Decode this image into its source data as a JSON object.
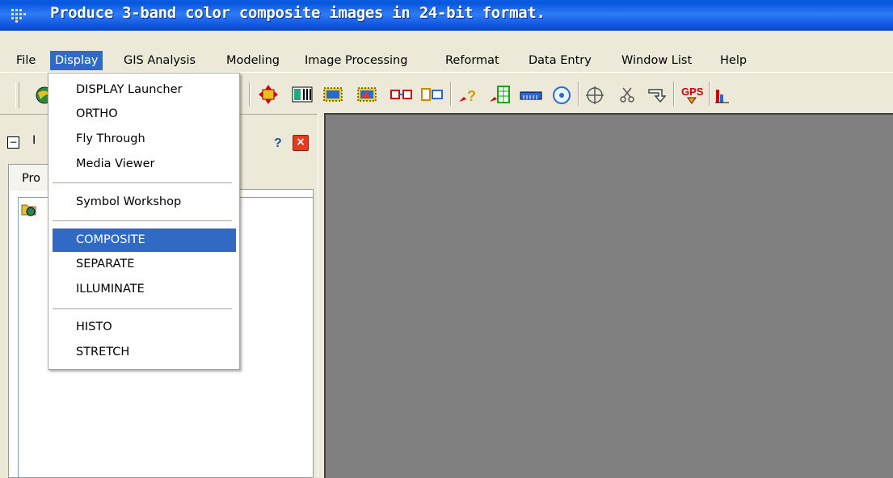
{
  "window": {
    "title": "Produce 3-band color composite images in 24-bit format."
  },
  "menubar": {
    "items": [
      {
        "label": "File"
      },
      {
        "label": "Display",
        "active": true
      },
      {
        "label": "GIS Analysis"
      },
      {
        "label": "Modeling"
      },
      {
        "label": "Image Processing"
      },
      {
        "label": "Reformat"
      },
      {
        "label": "Data Entry"
      },
      {
        "label": "Window List"
      },
      {
        "label": "Help"
      }
    ]
  },
  "display_menu": {
    "items": [
      {
        "label": "DISPLAY Launcher"
      },
      {
        "label": "ORTHO"
      },
      {
        "label": "Fly Through"
      },
      {
        "label": "Media Viewer"
      },
      {
        "label": "Symbol Workshop"
      },
      {
        "label": "COMPOSITE",
        "selected": true
      },
      {
        "label": "SEPARATE"
      },
      {
        "label": "ILLUMINATE"
      },
      {
        "label": "HISTO"
      },
      {
        "label": "STRETCH"
      }
    ]
  },
  "toolbar": {
    "icons": [
      "globe-icon",
      "expand-icon",
      "book-icon",
      "select-rect-icon",
      "image-window-icon",
      "link-icon",
      "windows-icon",
      "query-icon",
      "table-icon",
      "ruler-icon",
      "target-icon",
      "crosshair-icon",
      "scissors-icon",
      "arrow-down-icon",
      "gps-icon",
      "chart-icon"
    ],
    "gps_label": "GPS"
  },
  "left_panel": {
    "title_fragment": "I",
    "tab_label": "Pro"
  },
  "colors": {
    "titlebar": "#0a5ee0",
    "menu_highlight": "#316ac5",
    "viewer_bg": "#808080",
    "panel_bg": "#ece9d8"
  }
}
